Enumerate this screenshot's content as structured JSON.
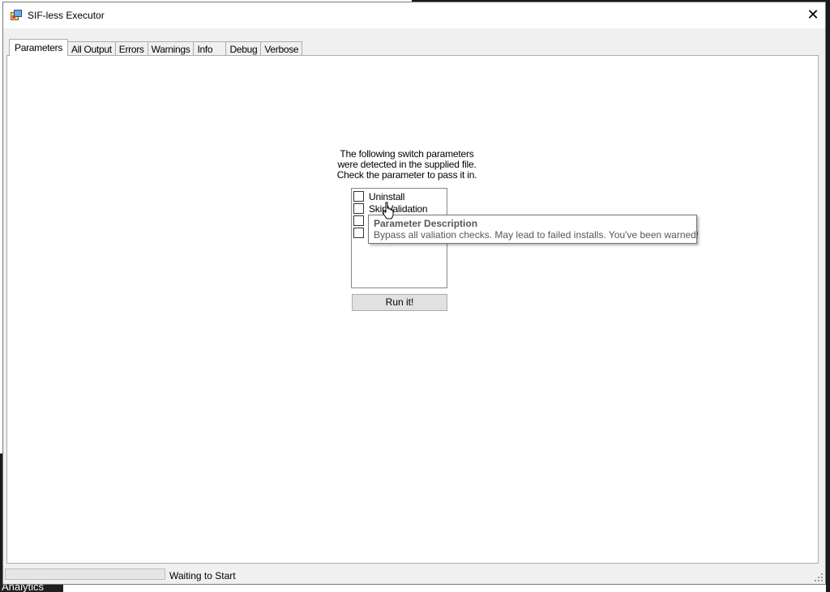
{
  "window": {
    "title": "SIF-less Executor",
    "close_symbol": "✕"
  },
  "desktop": {
    "taskbar_text": "Analytics"
  },
  "tabs": [
    {
      "label": "Parameters",
      "active": true
    },
    {
      "label": "All Output",
      "active": false
    },
    {
      "label": "Errors",
      "active": false
    },
    {
      "label": "Warnings",
      "active": false
    },
    {
      "label": "Info",
      "active": false
    },
    {
      "label": "Debug",
      "active": false
    },
    {
      "label": "Verbose",
      "active": false
    }
  ],
  "parameters": {
    "instructions": "The following switch parameters were detected in the supplied file.  Check the parameter to pass it in.",
    "items": [
      {
        "label": "Uninstall",
        "checked": false
      },
      {
        "label": "SkipValidation",
        "checked": false
      },
      {
        "label": "",
        "checked": false
      },
      {
        "label": "",
        "checked": false
      }
    ],
    "run_button": "Run it!"
  },
  "tooltip": {
    "title": "Parameter Description",
    "body": "Bypass all valiation checks. May lead to failed installs. You've been warned!"
  },
  "status": {
    "progress_fraction": 0,
    "text": "Waiting to Start"
  },
  "icons": {
    "app": "app-window-icon",
    "cursor": "mouse-pointer-icon",
    "grip": "resize-grip-icon"
  }
}
